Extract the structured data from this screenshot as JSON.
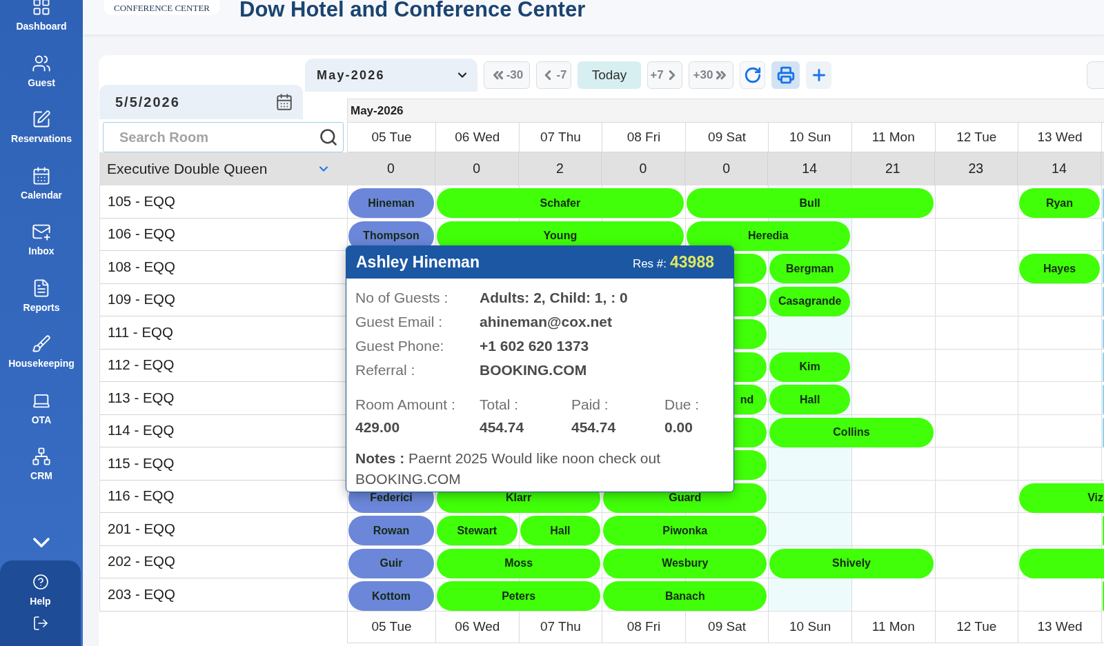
{
  "sidebar": {
    "items": [
      {
        "label": "Dashboard"
      },
      {
        "label": "Guest"
      },
      {
        "label": "Reservations"
      },
      {
        "label": "Calendar"
      },
      {
        "label": "Inbox"
      },
      {
        "label": "Reports"
      },
      {
        "label": "Housekeeping"
      },
      {
        "label": "OTA"
      },
      {
        "label": "CRM"
      }
    ],
    "help": {
      "label": "Help"
    }
  },
  "header": {
    "logo_text": "CONFERENCE CENTER",
    "title": "Dow Hotel and Conference Center"
  },
  "toolbar": {
    "month_select": "May-2026",
    "buttons": [
      {
        "kind": "back_month",
        "label": "-30"
      },
      {
        "kind": "back_week",
        "label": "-7"
      },
      {
        "kind": "today",
        "label": "Today"
      },
      {
        "kind": "forward_week",
        "label": "+7"
      },
      {
        "kind": "forward_month",
        "label": "+30"
      },
      {
        "kind": "refresh"
      },
      {
        "kind": "print"
      },
      {
        "kind": "add"
      }
    ]
  },
  "date_field": {
    "value": "5/5/2026"
  },
  "search": {
    "placeholder": "Search Room"
  },
  "room_type": {
    "label": "Executive Double Queen"
  },
  "grid": {
    "month": "May-2026",
    "days": [
      {
        "label": "05 Tue",
        "count": "0",
        "highlighted": false
      },
      {
        "label": "06 Wed",
        "count": "0",
        "highlighted": false
      },
      {
        "label": "07 Thu",
        "count": "2",
        "highlighted": false
      },
      {
        "label": "08 Fri",
        "count": "0",
        "highlighted": false
      },
      {
        "label": "09 Sat",
        "count": "0",
        "highlighted": false
      },
      {
        "label": "10 Sun",
        "count": "14",
        "highlighted": true
      },
      {
        "label": "11 Mon",
        "count": "21",
        "highlighted": false
      },
      {
        "label": "12 Tue",
        "count": "23",
        "highlighted": false
      },
      {
        "label": "13 Wed",
        "count": "14",
        "highlighted": false
      }
    ],
    "rooms": [
      {
        "name": "105 - EQQ",
        "cells": [
          {
            "kind": "start",
            "guest": "Hineman",
            "color": "#6c87d9"
          },
          {
            "kind": "start",
            "guest": "Schafer",
            "color": "#40ff08"
          },
          {
            "kind": "continue"
          },
          {
            "kind": "continue"
          },
          {
            "kind": "start",
            "guest": "Bull",
            "color": "#40ff08"
          },
          {
            "kind": "continue"
          },
          {
            "kind": "continue"
          },
          {
            "kind": "empty"
          },
          {
            "kind": "start",
            "guest": "Ryan",
            "color": "#40ff08"
          },
          {
            "kind": "start",
            "color": "#8fcff4"
          }
        ]
      },
      {
        "name": "106 - EQQ",
        "cells": [
          {
            "kind": "start",
            "guest": "Thompson",
            "color": "#6c87d9"
          },
          {
            "kind": "start",
            "guest": "Young",
            "color": "#40ff08"
          },
          {
            "kind": "continue"
          },
          {
            "kind": "continue"
          },
          {
            "kind": "start",
            "guest": "Heredia",
            "color": "#40ff08"
          },
          {
            "kind": "continue"
          },
          {
            "kind": "empty"
          },
          {
            "kind": "empty"
          },
          {
            "kind": "empty"
          },
          {
            "kind": "start",
            "color": "#8fcff4"
          }
        ]
      },
      {
        "name": "108 - EQQ",
        "cells": [
          {
            "kind": "empty"
          },
          {
            "kind": "empty"
          },
          {
            "kind": "empty"
          },
          {
            "kind": "empty"
          },
          {
            "kind": "tail",
            "color": "#40ff08"
          },
          {
            "kind": "start",
            "guest": "Bergman",
            "color": "#40ff08"
          },
          {
            "kind": "empty"
          },
          {
            "kind": "empty"
          },
          {
            "kind": "start",
            "guest": "Hayes",
            "color": "#40ff08"
          },
          {
            "kind": "start",
            "color": "#8fcff4"
          }
        ]
      },
      {
        "name": "109 - EQQ",
        "cells": [
          {
            "kind": "empty"
          },
          {
            "kind": "empty"
          },
          {
            "kind": "empty"
          },
          {
            "kind": "empty"
          },
          {
            "kind": "tail",
            "color": "#40ff08"
          },
          {
            "kind": "start",
            "guest": "Casagrande",
            "color": "#40ff08"
          },
          {
            "kind": "empty"
          },
          {
            "kind": "empty"
          },
          {
            "kind": "empty"
          },
          {
            "kind": "start",
            "color": "#8fcff4"
          }
        ]
      },
      {
        "name": "111 - EQQ",
        "cells": [
          {
            "kind": "empty"
          },
          {
            "kind": "empty"
          },
          {
            "kind": "empty"
          },
          {
            "kind": "empty"
          },
          {
            "kind": "tail",
            "color": "#40ff08"
          },
          {
            "kind": "empty"
          },
          {
            "kind": "empty"
          },
          {
            "kind": "empty"
          },
          {
            "kind": "empty"
          },
          {
            "kind": "start",
            "color": "#8fcff4"
          }
        ]
      },
      {
        "name": "112 - EQQ",
        "cells": [
          {
            "kind": "empty"
          },
          {
            "kind": "empty"
          },
          {
            "kind": "empty"
          },
          {
            "kind": "empty"
          },
          {
            "kind": "tail",
            "color": "#40ff08"
          },
          {
            "kind": "start",
            "guest": "Kim",
            "color": "#40ff08"
          },
          {
            "kind": "empty"
          },
          {
            "kind": "empty"
          },
          {
            "kind": "empty"
          },
          {
            "kind": "start",
            "color": "#8fcff4"
          }
        ]
      },
      {
        "name": "113 - EQQ",
        "cells": [
          {
            "kind": "empty"
          },
          {
            "kind": "empty"
          },
          {
            "kind": "empty"
          },
          {
            "kind": "empty"
          },
          {
            "kind": "tail",
            "guest": "nd",
            "color": "#40ff08"
          },
          {
            "kind": "start",
            "guest": "Hall",
            "color": "#40ff08"
          },
          {
            "kind": "empty"
          },
          {
            "kind": "empty"
          },
          {
            "kind": "empty"
          },
          {
            "kind": "start",
            "color": "#8fcff4"
          }
        ]
      },
      {
        "name": "114 - EQQ",
        "cells": [
          {
            "kind": "empty"
          },
          {
            "kind": "empty"
          },
          {
            "kind": "empty"
          },
          {
            "kind": "empty"
          },
          {
            "kind": "tail",
            "color": "#40ff08"
          },
          {
            "kind": "start",
            "guest": "Collins",
            "color": "#40ff08"
          },
          {
            "kind": "continue"
          },
          {
            "kind": "empty"
          },
          {
            "kind": "empty"
          },
          {
            "kind": "start",
            "color": "#8fcff4"
          }
        ]
      },
      {
        "name": "115 - EQQ",
        "cells": [
          {
            "kind": "empty"
          },
          {
            "kind": "empty"
          },
          {
            "kind": "empty"
          },
          {
            "kind": "empty"
          },
          {
            "kind": "tail",
            "color": "#40ff08"
          },
          {
            "kind": "empty"
          },
          {
            "kind": "empty"
          },
          {
            "kind": "empty"
          },
          {
            "kind": "empty"
          },
          {
            "kind": "empty"
          }
        ]
      },
      {
        "name": "116 - EQQ",
        "cells": [
          {
            "kind": "start",
            "guest": "Federici",
            "color": "#6c87d9"
          },
          {
            "kind": "start",
            "guest": "Klarr",
            "color": "#40ff08"
          },
          {
            "kind": "continue"
          },
          {
            "kind": "start",
            "guest": "Guard",
            "color": "#40ff08"
          },
          {
            "kind": "continue"
          },
          {
            "kind": "empty"
          },
          {
            "kind": "empty"
          },
          {
            "kind": "empty"
          },
          {
            "kind": "head",
            "guest": "Viz",
            "color": "#40ff08"
          },
          {
            "kind": "continue"
          }
        ]
      },
      {
        "name": "201 - EQQ",
        "cells": [
          {
            "kind": "start",
            "guest": "Rowan",
            "color": "#6c87d9"
          },
          {
            "kind": "start",
            "guest": "Stewart",
            "color": "#40ff08"
          },
          {
            "kind": "start",
            "guest": "Hall",
            "color": "#40ff08"
          },
          {
            "kind": "start",
            "guest": "Piwonka",
            "color": "#40ff08"
          },
          {
            "kind": "continue"
          },
          {
            "kind": "empty"
          },
          {
            "kind": "empty"
          },
          {
            "kind": "empty"
          },
          {
            "kind": "empty"
          },
          {
            "kind": "start",
            "color": "#40ff08"
          }
        ]
      },
      {
        "name": "202 - EQQ",
        "cells": [
          {
            "kind": "start",
            "guest": "Guir",
            "color": "#6c87d9"
          },
          {
            "kind": "start",
            "guest": "Moss",
            "color": "#40ff08"
          },
          {
            "kind": "continue"
          },
          {
            "kind": "start",
            "guest": "Wesbury",
            "color": "#40ff08"
          },
          {
            "kind": "continue"
          },
          {
            "kind": "start",
            "guest": "Shively",
            "color": "#40ff08"
          },
          {
            "kind": "continue"
          },
          {
            "kind": "empty"
          },
          {
            "kind": "head",
            "color": "#40ff08"
          },
          {
            "kind": "continue"
          }
        ]
      },
      {
        "name": "203 - EQQ",
        "cells": [
          {
            "kind": "start",
            "guest": "Kottom",
            "color": "#6c87d9"
          },
          {
            "kind": "start",
            "guest": "Peters",
            "color": "#40ff08"
          },
          {
            "kind": "continue"
          },
          {
            "kind": "start",
            "guest": "Banach",
            "color": "#40ff08"
          },
          {
            "kind": "continue"
          },
          {
            "kind": "empty"
          },
          {
            "kind": "empty"
          },
          {
            "kind": "empty"
          },
          {
            "kind": "empty"
          },
          {
            "kind": "start",
            "color": "#40ff08"
          }
        ]
      }
    ],
    "footer_days": [
      "05 Tue",
      "06 Wed",
      "07 Thu",
      "08 Fri",
      "09 Sat",
      "10 Sun",
      "11 Mon",
      "12 Tue",
      "13 Wed"
    ]
  },
  "popup": {
    "guest_name": "Ashley Hineman",
    "res_label": "Res #:",
    "res_number": "43988",
    "details": [
      {
        "label": "No of Guests :",
        "value": "Adults: 2, Child: 1, : 0"
      },
      {
        "label": "Guest Email :",
        "value": "ahineman@cox.net"
      },
      {
        "label": "Guest Phone:",
        "value": "+1 602 620 1373"
      },
      {
        "label": "Referral :",
        "value": "BOOKING.COM"
      }
    ],
    "amounts": [
      {
        "label": "Room Amount :",
        "value": "429.00"
      },
      {
        "label": "Total :",
        "value": "454.74"
      },
      {
        "label": "Paid :",
        "value": "454.74"
      },
      {
        "label": "Due :",
        "value": "0.00"
      }
    ],
    "notes": {
      "label": "Notes :",
      "lines": [
        "Paernt 2025 Would like noon check out",
        "BOOKING.COM"
      ]
    }
  }
}
